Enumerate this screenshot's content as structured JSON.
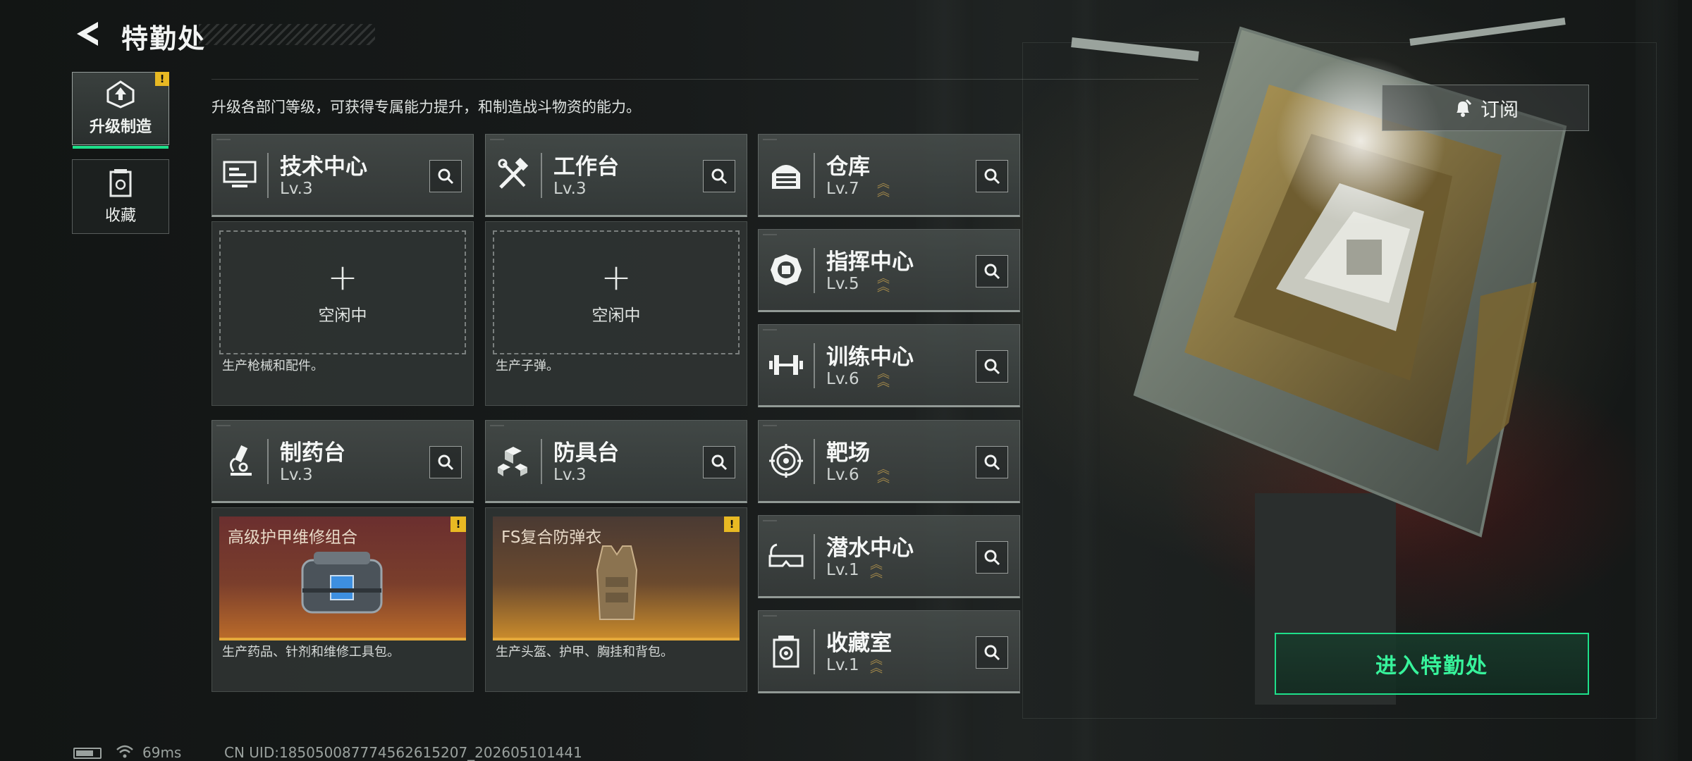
{
  "header": {
    "title": "特勤处",
    "description": "升级各部门等级，可获得专属能力提升，和制造战斗物资的能力。"
  },
  "sidebar": {
    "items": [
      {
        "label": "升级制造",
        "icon": "upgrade-icon",
        "active": true,
        "warning": "!"
      },
      {
        "label": "收藏",
        "icon": "collection-icon",
        "active": false
      }
    ]
  },
  "departments": [
    {
      "name": "技术中心",
      "level": "Lv.3",
      "icon": "monitor-icon",
      "max": false
    },
    {
      "name": "工作台",
      "level": "Lv.3",
      "icon": "tools-icon",
      "max": false
    },
    {
      "name": "仓库",
      "level": "Lv.7",
      "icon": "warehouse-icon",
      "max": true
    },
    {
      "name": "指挥中心",
      "level": "Lv.5",
      "icon": "chip-icon",
      "max": true
    },
    {
      "name": "训练中心",
      "level": "Lv.6",
      "icon": "dumbbell-icon",
      "max": true
    },
    {
      "name": "制药台",
      "level": "Lv.3",
      "icon": "microscope-icon",
      "max": false
    },
    {
      "name": "防具台",
      "level": "Lv.3",
      "icon": "cubes-icon",
      "max": false
    },
    {
      "name": "靶场",
      "level": "Lv.6",
      "icon": "target-icon",
      "max": true
    },
    {
      "name": "潜水中心",
      "level": "Lv.1",
      "icon": "goggles-icon",
      "max": true
    },
    {
      "name": "收藏室",
      "level": "Lv.1",
      "icon": "vault-icon",
      "max": true
    }
  ],
  "slots": [
    {
      "state": "idle",
      "label": "空闲中",
      "note": "生产枪械和配件。"
    },
    {
      "state": "idle",
      "label": "空闲中",
      "note": "生产子弹。"
    },
    {
      "state": "producing",
      "item": "高级护甲维修组合",
      "warning": "!",
      "note": "生产药品、针剂和维修工具包。"
    },
    {
      "state": "producing",
      "item": "FS复合防弹衣",
      "warning": "!",
      "note": "生产头盔、护甲、胸挂和背包。"
    }
  ],
  "actions": {
    "subscribe_label": "订阅",
    "enter_label": "进入特勤处"
  },
  "status_bar": {
    "ping": "69ms",
    "uid": "CN UID:185050087774562615207_202605101441"
  },
  "colors": {
    "accent_green": "#1ee08a",
    "warning_yellow": "#e8b923",
    "maxed_chevron": "#a58a4a"
  }
}
